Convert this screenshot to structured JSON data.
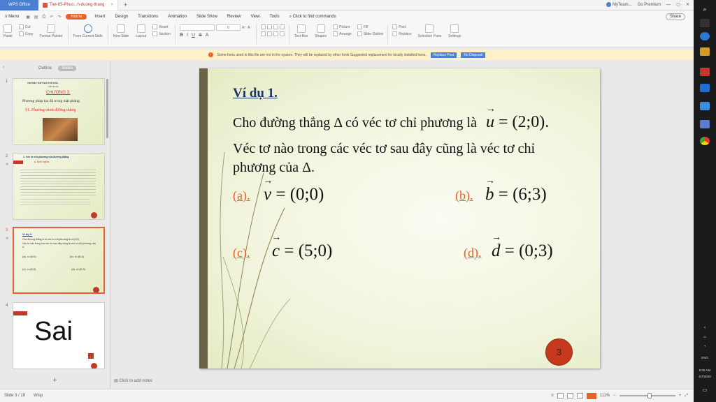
{
  "titlebar": {
    "app_tab": "WPS Office",
    "doc_tab": "Tiet-85-Phuo...h-duong-thang",
    "account": "MyTeam...",
    "premium": "Go Premium"
  },
  "menu": {
    "menu_label": "Menu",
    "items": [
      "Home",
      "Insert",
      "Design",
      "Transitions",
      "Animation",
      "Slide Show",
      "Review",
      "View",
      "Tools"
    ],
    "search": "Click to find commands",
    "share": "Share"
  },
  "ribbon": {
    "paste": "Paste",
    "cut": "Cut",
    "copy": "Copy",
    "format_painter": "Format Painter",
    "from_current_slide": "From Current Slide",
    "new_slide": "New Slide",
    "layout": "Layout",
    "reset": "Reset",
    "section": "Section",
    "font_size": "0",
    "text_box": "Text Box",
    "shapes": "Shapes",
    "picture": "Picture",
    "arrange": "Arrange",
    "fill": "Fill",
    "slide_outline": "Slide Outline",
    "find": "Find",
    "replace": "Replace",
    "selection_pane": "Selection Pane",
    "settings": "Settings"
  },
  "notice": {
    "text": "Some fonts used in this file are not in the system. They will be replaced by other fonts Suggested replacement for locally installed fonts.",
    "btn1": "Replace Font",
    "btn2": "No Disposal"
  },
  "left_panel": {
    "tab_outline": "Outline",
    "tab_slides": "Slides",
    "thumbs": [
      {
        "num": "1",
        "lines": [
          "TRƯỜNG THPT NGUYỄN TRÃI",
          "LỚP 10 A1",
          "CHƯƠNG 3.",
          "Phương pháp tọa độ trong mặt phẳng.",
          "§1. Phương trình đường thẳng"
        ]
      },
      {
        "num": "2",
        "lines": [
          "1. Véc tơ chỉ phương của đường thẳng.",
          "a. Định nghĩa."
        ]
      },
      {
        "num": "3",
        "lines": [
          "Ví dụ 1.",
          "Cho đường thẳng Δ có véc tơ chỉ phương là u=(2;0)",
          "Véc tơ nào trong các véc tơ sau đây cũng là véc tơ chỉ phương của Δ.",
          "(a). v=(0;0)",
          "(b). b=(6;3)",
          "(c). c=(5;0)",
          "(d). d=(0;3)"
        ]
      },
      {
        "num": "4",
        "lines": [
          "Sai"
        ]
      }
    ],
    "add_slide": "+"
  },
  "slide": {
    "title": "Ví dụ 1.",
    "line1_text": "Cho đường thẳng Δ có véc tơ chỉ phương là",
    "line1_vec": "u",
    "line1_rest": " = (2;0).",
    "line2": "Véc tơ nào trong các véc tơ sau đây cũng là véc tơ chỉ",
    "line3": "phương của Δ.",
    "options": [
      {
        "label": "(a).",
        "vec": "v",
        "value": " = (0;0)"
      },
      {
        "label": "(b).",
        "vec": "b",
        "value": " = (6;3)"
      },
      {
        "label": "(c).",
        "vec": "c",
        "value": " = (5;0)"
      },
      {
        "label": "(d).",
        "vec": "d",
        "value": " = (0;3)"
      }
    ],
    "slide_number": "3"
  },
  "notes": "Click to add notes",
  "status": {
    "slide_info": "Slide 3 / 19",
    "theme": "Wisp",
    "zoom": "111%",
    "zoom_fraction": 0.55
  },
  "taskbar": {
    "lang": "ENG",
    "time": "9:05 AM",
    "date": "4/7/2020"
  }
}
